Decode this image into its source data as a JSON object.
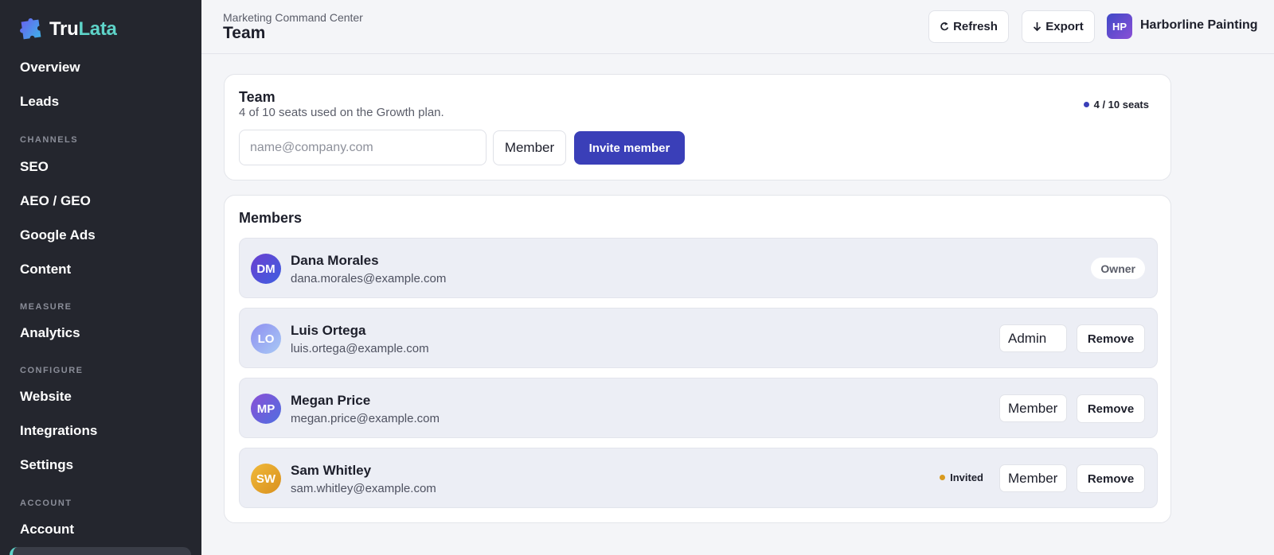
{
  "brand": {
    "name_part1": "Tru",
    "name_part2": "Lata",
    "logo_icon": "puzzle-logo-icon"
  },
  "sidebar": {
    "items": [
      {
        "label": "Overview"
      },
      {
        "label": "Leads"
      },
      {
        "section": "CHANNELS"
      },
      {
        "label": "SEO"
      },
      {
        "label": "AEO / GEO"
      },
      {
        "label": "Google Ads"
      },
      {
        "label": "Content"
      },
      {
        "section": "MEASURE"
      },
      {
        "label": "Analytics"
      },
      {
        "section": "CONFIGURE"
      },
      {
        "label": "Website"
      },
      {
        "label": "Integrations"
      },
      {
        "label": "Settings"
      },
      {
        "section": "ACCOUNT"
      },
      {
        "label": "Account"
      }
    ]
  },
  "header": {
    "breadcrumb": "Marketing Command Center",
    "title": "Team",
    "refresh_label": "Refresh",
    "export_label": "Export",
    "org_initials": "HP",
    "org_name": "Harborline Painting"
  },
  "invite": {
    "title": "Team",
    "subtitle": "4 of 10 seats used on the Growth plan.",
    "seats_badge": "4 / 10 seats",
    "email_placeholder": "name@company.com",
    "role_value": "Member",
    "invite_button": "Invite member"
  },
  "members": {
    "title": "Members",
    "remove_label": "Remove",
    "rows": [
      {
        "initials": "DM",
        "name": "Dana Morales",
        "email": "dana.morales@example.com",
        "badge": "Owner"
      },
      {
        "initials": "LO",
        "name": "Luis Ortega",
        "email": "luis.ortega@example.com",
        "role": "Admin"
      },
      {
        "initials": "MP",
        "name": "Megan Price",
        "email": "megan.price@example.com",
        "role": "Member"
      },
      {
        "initials": "SW",
        "name": "Sam Whitley",
        "email": "sam.whitley@example.com",
        "role": "Member",
        "status": "Invited"
      }
    ]
  },
  "colors": {
    "accent": "#3a3fb8",
    "brand_teal": "#5ed3c8",
    "sidebar_bg": "#24262e",
    "invited_dot": "#d99a1e",
    "seats_dot": "#3a3fb8"
  }
}
